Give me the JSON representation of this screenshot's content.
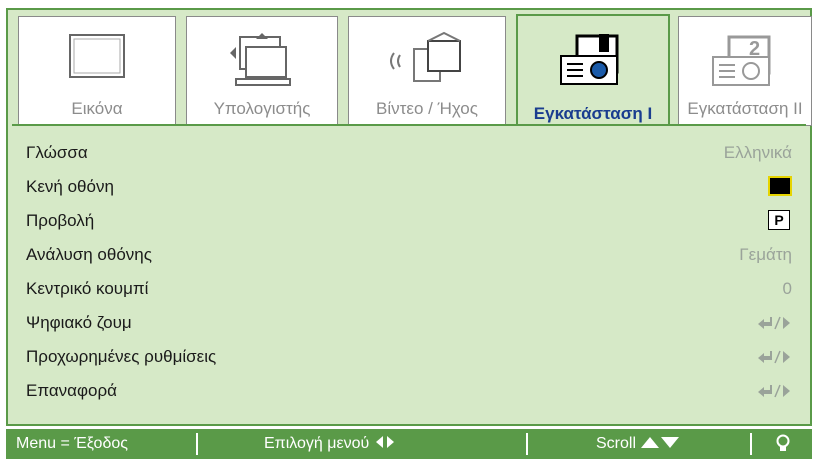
{
  "tabs": [
    {
      "label": "Εικόνα",
      "icon": "monitor-icon"
    },
    {
      "label": "Υπολογιστής",
      "icon": "computer-icon"
    },
    {
      "label": "Βίντεο / Ήχος",
      "icon": "video-audio-icon"
    },
    {
      "label": "Εγκατάσταση I",
      "icon": "projector-setup-icon",
      "active": true
    },
    {
      "label": "Εγκατάσταση II",
      "icon": "projector-setup-2-icon"
    }
  ],
  "menu": [
    {
      "label": "Γλώσσα",
      "value": "Ελληνικά"
    },
    {
      "label": "Κενή οθόνη",
      "value_type": "black-box"
    },
    {
      "label": "Προβολή",
      "value": "P"
    },
    {
      "label": "Ανάλυση οθόνης",
      "value": "Γεμάτη"
    },
    {
      "label": "Κεντρικό κουμπί",
      "value": "0"
    },
    {
      "label": "Ψηφιακό ζουμ",
      "value_type": "enter-arrow"
    },
    {
      "label": "Προχωρημένες ρυθμίσεις",
      "value_type": "enter-arrow"
    },
    {
      "label": "Επαναφορά",
      "value_type": "enter-arrow"
    }
  ],
  "statusbar": {
    "exit": "Menu = Έξοδος",
    "select": "Επιλογή μενού",
    "select_icon": "left-right-arrows-icon",
    "scroll": "Scroll",
    "scroll_icon": "up-down-arrows-icon",
    "lamp_icon": "lamp-icon"
  },
  "colors": {
    "frame": "#5a9a48",
    "panel": "#d6e9c7",
    "active_tab_text": "#1a3d8f"
  }
}
